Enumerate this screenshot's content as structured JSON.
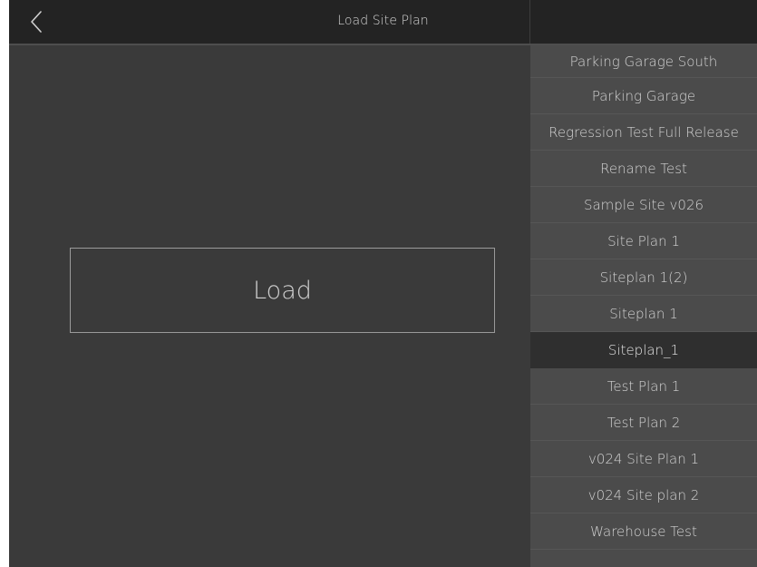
{
  "header": {
    "title": "Load Site Plan",
    "back_icon": "chevron-left-icon"
  },
  "main": {
    "load_label": "Load"
  },
  "site_plans": {
    "selected_index": 8,
    "items": [
      {
        "label": "Parking Garage South"
      },
      {
        "label": "Parking Garage"
      },
      {
        "label": "Regression Test Full Release"
      },
      {
        "label": "Rename Test"
      },
      {
        "label": "Sample Site v026"
      },
      {
        "label": "Site Plan 1"
      },
      {
        "label": "Siteplan 1(2)"
      },
      {
        "label": "Siteplan 1"
      },
      {
        "label": "Siteplan_1"
      },
      {
        "label": "Test Plan 1"
      },
      {
        "label": "Test Plan 2"
      },
      {
        "label": "v024 Site Plan 1"
      },
      {
        "label": "v024 Site plan 2"
      },
      {
        "label": "Warehouse Test"
      }
    ]
  },
  "colors": {
    "header_bg": "#232323",
    "main_bg": "#3a3a3a",
    "list_bg": "#4b4b4b",
    "selected_bg": "#2f2f2f",
    "text": "#d2d2d2"
  }
}
